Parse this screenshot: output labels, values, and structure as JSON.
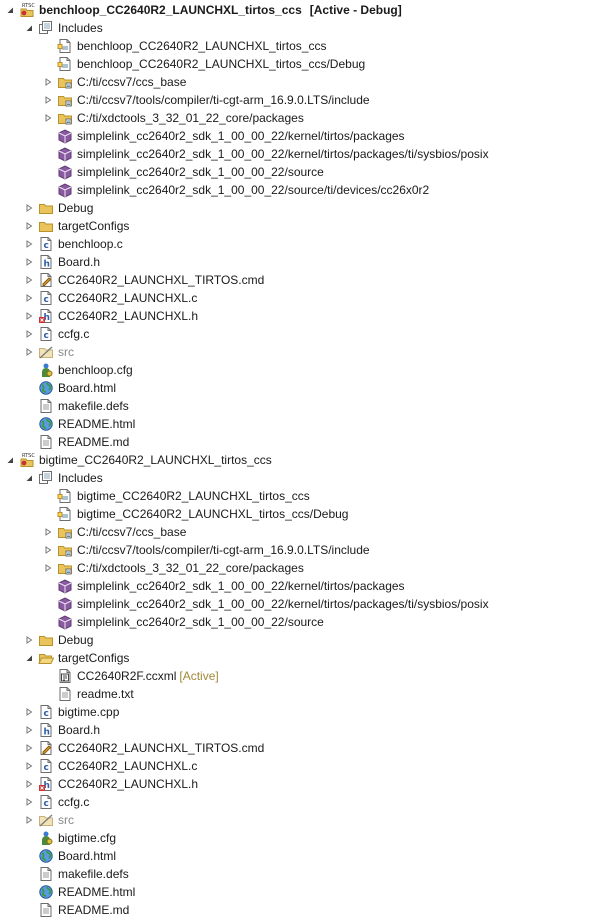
{
  "tree": {
    "rows": [
      {
        "level": 0,
        "toggle": "open",
        "icon": "rtsc-project",
        "label": "benchloop_CC2640R2_LAUNCHXL_tirtos_ccs",
        "suffix": "[Active - Debug]",
        "active": true
      },
      {
        "level": 1,
        "toggle": "open",
        "icon": "includes",
        "label": "Includes"
      },
      {
        "level": 2,
        "toggle": "none",
        "icon": "include-project",
        "label": "benchloop_CC2640R2_LAUNCHXL_tirtos_ccs"
      },
      {
        "level": 2,
        "toggle": "none",
        "icon": "include-project",
        "label": "benchloop_CC2640R2_LAUNCHXL_tirtos_ccs/Debug"
      },
      {
        "level": 2,
        "toggle": "closed",
        "icon": "include-folder",
        "label": "C:/ti/ccsv7/ccs_base"
      },
      {
        "level": 2,
        "toggle": "closed",
        "icon": "include-folder",
        "label": "C:/ti/ccsv7/tools/compiler/ti-cgt-arm_16.9.0.LTS/include"
      },
      {
        "level": 2,
        "toggle": "closed",
        "icon": "include-folder",
        "label": "C:/ti/xdctools_3_32_01_22_core/packages"
      },
      {
        "level": 2,
        "toggle": "none",
        "icon": "package",
        "label": "simplelink_cc2640r2_sdk_1_00_00_22/kernel/tirtos/packages"
      },
      {
        "level": 2,
        "toggle": "none",
        "icon": "package",
        "label": "simplelink_cc2640r2_sdk_1_00_00_22/kernel/tirtos/packages/ti/sysbios/posix"
      },
      {
        "level": 2,
        "toggle": "none",
        "icon": "package",
        "label": "simplelink_cc2640r2_sdk_1_00_00_22/source"
      },
      {
        "level": 2,
        "toggle": "none",
        "icon": "package",
        "label": "simplelink_cc2640r2_sdk_1_00_00_22/source/ti/devices/cc26x0r2"
      },
      {
        "level": 1,
        "toggle": "closed",
        "icon": "folder",
        "label": "Debug"
      },
      {
        "level": 1,
        "toggle": "closed",
        "icon": "folder",
        "label": "targetConfigs"
      },
      {
        "level": 1,
        "toggle": "closed",
        "icon": "c-file",
        "label": "benchloop.c"
      },
      {
        "level": 1,
        "toggle": "closed",
        "icon": "h-file",
        "label": "Board.h"
      },
      {
        "level": 1,
        "toggle": "closed",
        "icon": "cmd-file",
        "label": "CC2640R2_LAUNCHXL_TIRTOS.cmd"
      },
      {
        "level": 1,
        "toggle": "closed",
        "icon": "c-file",
        "label": "CC2640R2_LAUNCHXL.c"
      },
      {
        "level": 1,
        "toggle": "closed",
        "icon": "h-file-error",
        "label": "CC2640R2_LAUNCHXL.h"
      },
      {
        "level": 1,
        "toggle": "closed",
        "icon": "c-file",
        "label": "ccfg.c"
      },
      {
        "level": 1,
        "toggle": "closed",
        "icon": "excluded-folder",
        "label": "src",
        "muted": true
      },
      {
        "level": 1,
        "toggle": "none",
        "icon": "cfg-file",
        "label": "benchloop.cfg"
      },
      {
        "level": 1,
        "toggle": "none",
        "icon": "html-file",
        "label": "Board.html"
      },
      {
        "level": 1,
        "toggle": "none",
        "icon": "text-file",
        "label": "makefile.defs"
      },
      {
        "level": 1,
        "toggle": "none",
        "icon": "html-file",
        "label": "README.html"
      },
      {
        "level": 1,
        "toggle": "none",
        "icon": "text-file",
        "label": "README.md"
      },
      {
        "level": 0,
        "toggle": "open",
        "icon": "rtsc-project",
        "label": "bigtime_CC2640R2_LAUNCHXL_tirtos_ccs",
        "active": false
      },
      {
        "level": 1,
        "toggle": "open",
        "icon": "includes",
        "label": "Includes"
      },
      {
        "level": 2,
        "toggle": "none",
        "icon": "include-project",
        "label": "bigtime_CC2640R2_LAUNCHXL_tirtos_ccs"
      },
      {
        "level": 2,
        "toggle": "none",
        "icon": "include-project",
        "label": "bigtime_CC2640R2_LAUNCHXL_tirtos_ccs/Debug"
      },
      {
        "level": 2,
        "toggle": "closed",
        "icon": "include-folder",
        "label": "C:/ti/ccsv7/ccs_base"
      },
      {
        "level": 2,
        "toggle": "closed",
        "icon": "include-folder",
        "label": "C:/ti/ccsv7/tools/compiler/ti-cgt-arm_16.9.0.LTS/include"
      },
      {
        "level": 2,
        "toggle": "closed",
        "icon": "include-folder",
        "label": "C:/ti/xdctools_3_32_01_22_core/packages"
      },
      {
        "level": 2,
        "toggle": "none",
        "icon": "package",
        "label": "simplelink_cc2640r2_sdk_1_00_00_22/kernel/tirtos/packages"
      },
      {
        "level": 2,
        "toggle": "none",
        "icon": "package",
        "label": "simplelink_cc2640r2_sdk_1_00_00_22/kernel/tirtos/packages/ti/sysbios/posix"
      },
      {
        "level": 2,
        "toggle": "none",
        "icon": "package",
        "label": "simplelink_cc2640r2_sdk_1_00_00_22/source"
      },
      {
        "level": 1,
        "toggle": "closed",
        "icon": "folder",
        "label": "Debug"
      },
      {
        "level": 1,
        "toggle": "open",
        "icon": "folder-open",
        "label": "targetConfigs"
      },
      {
        "level": 2,
        "toggle": "none",
        "icon": "ccxml-file",
        "label": "CC2640R2F.ccxml",
        "decoration": "[Active]"
      },
      {
        "level": 2,
        "toggle": "none",
        "icon": "text-file",
        "label": "readme.txt"
      },
      {
        "level": 1,
        "toggle": "closed",
        "icon": "c-file",
        "label": "bigtime.cpp"
      },
      {
        "level": 1,
        "toggle": "closed",
        "icon": "h-file",
        "label": "Board.h"
      },
      {
        "level": 1,
        "toggle": "closed",
        "icon": "cmd-file",
        "label": "CC2640R2_LAUNCHXL_TIRTOS.cmd"
      },
      {
        "level": 1,
        "toggle": "closed",
        "icon": "c-file",
        "label": "CC2640R2_LAUNCHXL.c"
      },
      {
        "level": 1,
        "toggle": "closed",
        "icon": "h-file-error",
        "label": "CC2640R2_LAUNCHXL.h"
      },
      {
        "level": 1,
        "toggle": "closed",
        "icon": "c-file",
        "label": "ccfg.c"
      },
      {
        "level": 1,
        "toggle": "closed",
        "icon": "excluded-folder",
        "label": "src",
        "muted": true
      },
      {
        "level": 1,
        "toggle": "none",
        "icon": "cfg-file",
        "label": "bigtime.cfg"
      },
      {
        "level": 1,
        "toggle": "none",
        "icon": "html-file",
        "label": "Board.html"
      },
      {
        "level": 1,
        "toggle": "none",
        "icon": "text-file",
        "label": "makefile.defs"
      },
      {
        "level": 1,
        "toggle": "none",
        "icon": "html-file",
        "label": "README.html"
      },
      {
        "level": 1,
        "toggle": "none",
        "icon": "text-file",
        "label": "README.md"
      }
    ]
  },
  "colors": {
    "folder": "#e8c45a",
    "folder_edge": "#b8912a",
    "c_badge": "#2b5ea8",
    "h_badge": "#2b5ea8",
    "error_badge": "#d03030",
    "package": "#8a5aa0",
    "muted_text": "#888888",
    "decoration": "#a08a3a"
  }
}
